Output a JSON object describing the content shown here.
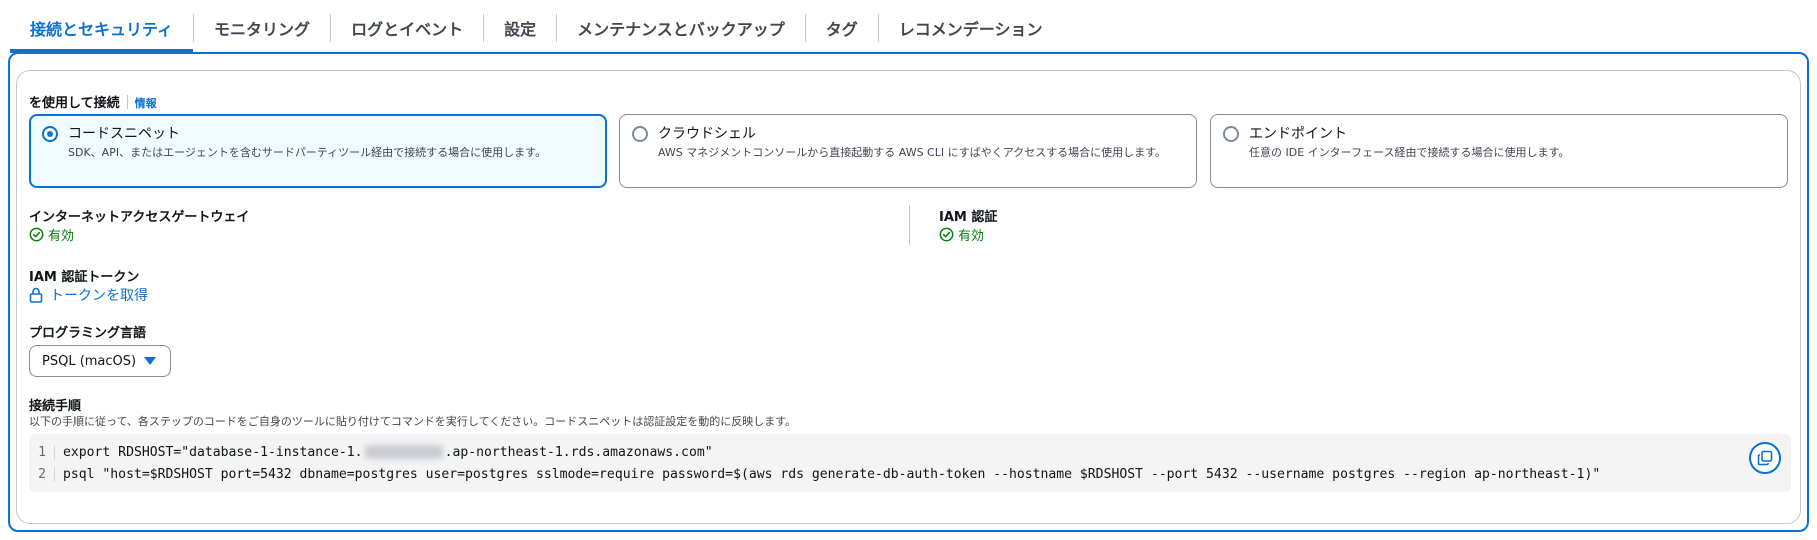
{
  "tabs": [
    {
      "label": "接続とセキュリティ",
      "active": true
    },
    {
      "label": "モニタリング"
    },
    {
      "label": "ログとイベント"
    },
    {
      "label": "設定"
    },
    {
      "label": "メンテナンスとバックアップ"
    },
    {
      "label": "タグ"
    },
    {
      "label": "レコメンデーション"
    }
  ],
  "connect_with": {
    "label": "を使用して接続",
    "info": "情報",
    "options": [
      {
        "title": "コードスニペット",
        "desc": "SDK、API、またはエージェントを含むサードパーティツール経由で接続する場合に使用します。",
        "selected": true
      },
      {
        "title": "クラウドシェル",
        "desc": "AWS マネジメントコンソールから直接起動する AWS CLI にすばやくアクセスする場合に使用します。"
      },
      {
        "title": "エンドポイント",
        "desc": "任意の IDE インターフェース経由で接続する場合に使用します。"
      }
    ]
  },
  "internet_gateway": {
    "label": "インターネットアクセスゲートウェイ",
    "status": "有効"
  },
  "iam_auth": {
    "label": "IAM 認証",
    "status": "有効"
  },
  "iam_token": {
    "label": "IAM 認証トークン",
    "link": "トークンを取得"
  },
  "language": {
    "label": "プログラミング言語",
    "selected": "PSQL (macOS)"
  },
  "instructions": {
    "label": "接続手順",
    "desc": "以下の手順に従って、各ステップのコードをご自身のツールに貼り付けてコマンドを実行してください。コードスニペットは認証設定を動的に反映します。"
  },
  "code": {
    "line1_no": "1",
    "line1_a": "export RDSHOST=\"database-1-instance-1.",
    "line1_b": ".ap-northeast-1.rds.amazonaws.com\"",
    "line2_no": "2",
    "line2": "psql \"host=$RDSHOST port=5432 dbname=postgres user=postgres sslmode=require password=$(aws rds generate-db-auth-token --hostname $RDSHOST --port 5432 --username postgres --region ap-northeast-1)\""
  },
  "colors": {
    "accent": "#0972d3",
    "success": "#037f0c"
  }
}
